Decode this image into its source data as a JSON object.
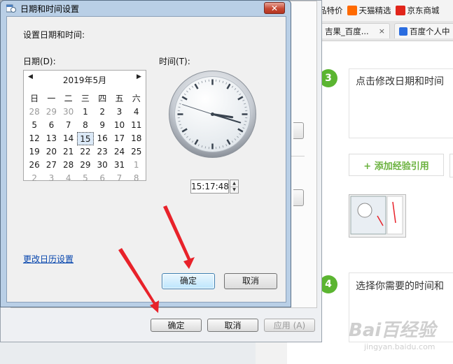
{
  "background": {
    "bookmarks": [
      {
        "label": "品特价",
        "icon": "none"
      },
      {
        "label": "天猫精选",
        "icon": "taobao-icon"
      },
      {
        "label": "京东商城",
        "icon": "jd-icon"
      }
    ],
    "tabs": [
      {
        "label": "吉果_百度..."
      },
      {
        "label": "百度个人中"
      }
    ],
    "tab_close": "×",
    "steps": [
      {
        "number": "3",
        "text": "点击修改日期和时间"
      },
      {
        "number": "4",
        "text": "选择你需要的时间和"
      }
    ],
    "add_ref_label": "+ 添加经验引用",
    "watermark": "Bai百经验",
    "watermark_url": "jingyan.baidu.com"
  },
  "parent_dialog": {
    "ok": "确定",
    "cancel": "取消",
    "apply": "应用 (A)"
  },
  "dialog": {
    "title": "日期和时间设置",
    "close": "✕",
    "heading": "设置日期和时间:",
    "date_label": "日期(D):",
    "time_label": "时间(T):",
    "calendar": {
      "month_title": "2019年5月",
      "prev": "◀",
      "next": "▶",
      "weekdays": [
        "日",
        "一",
        "二",
        "三",
        "四",
        "五",
        "六"
      ],
      "weeks": [
        [
          "28",
          "29",
          "30",
          "1",
          "2",
          "3",
          "4"
        ],
        [
          "5",
          "6",
          "7",
          "8",
          "9",
          "10",
          "11"
        ],
        [
          "12",
          "13",
          "14",
          "15",
          "16",
          "17",
          "18"
        ],
        [
          "19",
          "20",
          "21",
          "22",
          "23",
          "24",
          "25"
        ],
        [
          "26",
          "27",
          "28",
          "29",
          "30",
          "31",
          "1"
        ],
        [
          "2",
          "3",
          "4",
          "5",
          "6",
          "7",
          "8"
        ]
      ],
      "selected_day": "15"
    },
    "time_value": "15:17:48",
    "clock": {
      "hour": 15,
      "minute": 17,
      "second": 48
    },
    "change_calendar_link": "更改日历设置",
    "ok": "确定",
    "cancel": "取消"
  },
  "colors": {
    "accent_green": "#5bb531",
    "arrow_red": "#e8222a",
    "link_blue": "#0645ad"
  }
}
